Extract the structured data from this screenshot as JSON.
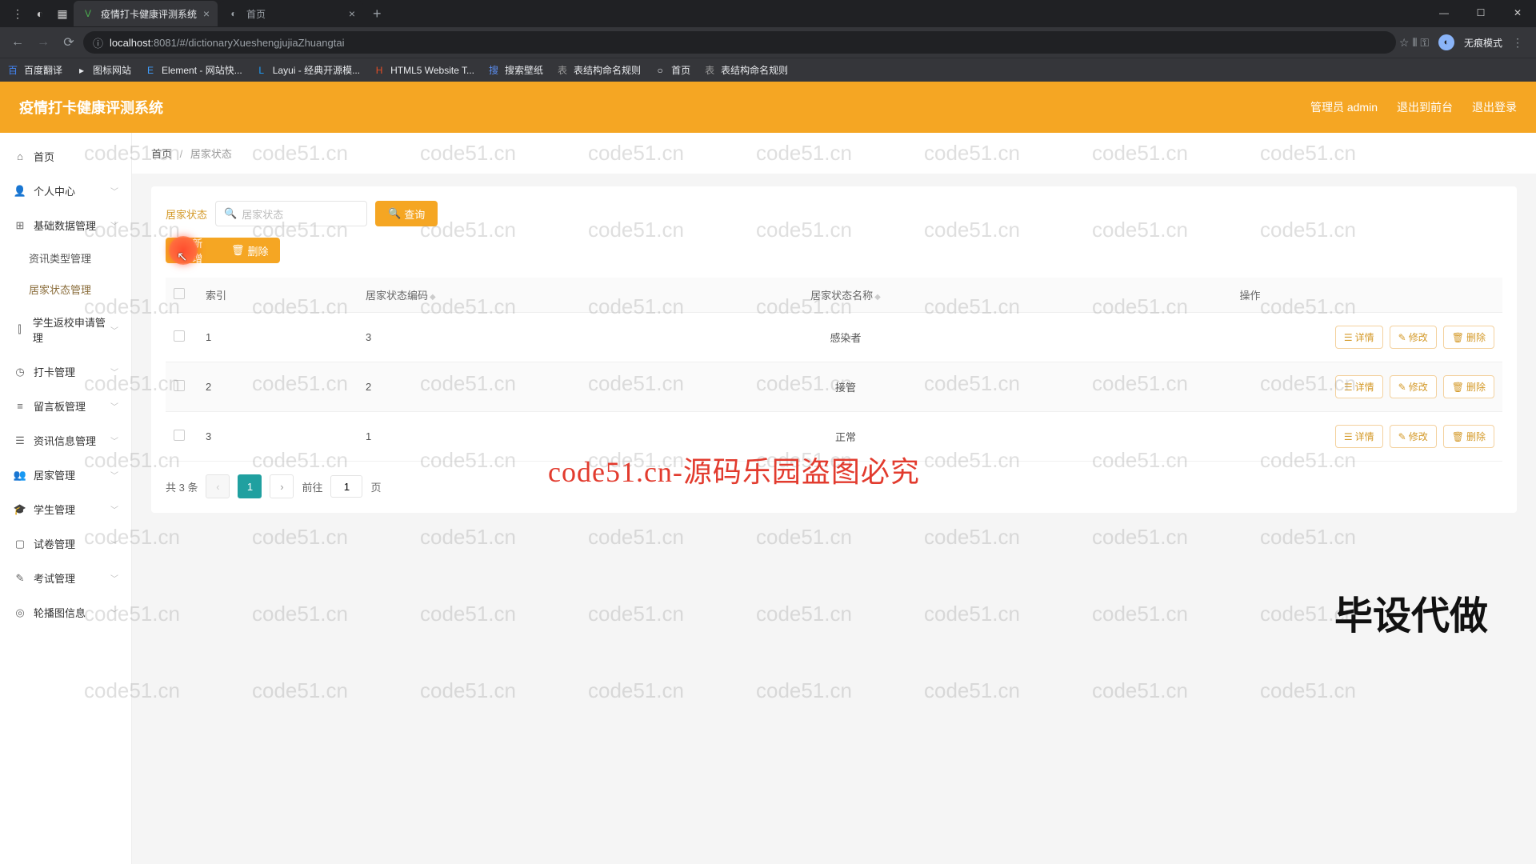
{
  "browser": {
    "tabs": [
      {
        "title": "疫情打卡健康评测系统",
        "active": true
      },
      {
        "title": "首页",
        "active": false
      }
    ],
    "url_prefix": "localhost",
    "url_port": ":8081",
    "url_path": "/#/dictionaryXueshengjujiaZhuangtai",
    "profile_label": "无痕模式",
    "bookmarks": [
      {
        "icon": "百",
        "label": "百度翻译"
      },
      {
        "icon": "▸",
        "label": "图标网站"
      },
      {
        "icon": "E",
        "label": "Element - 网站快..."
      },
      {
        "icon": "L",
        "label": "Layui - 经典开源模..."
      },
      {
        "icon": "H",
        "label": "HTML5 Website T..."
      },
      {
        "icon": "搜",
        "label": "搜索壁纸"
      },
      {
        "icon": "表",
        "label": "表结构命名规则"
      },
      {
        "icon": "○",
        "label": "首页"
      },
      {
        "icon": "表",
        "label": "表结构命名规则"
      }
    ]
  },
  "header": {
    "app_title": "疫情打卡健康评测系统",
    "user_label": "管理员 admin",
    "logout_front": "退出到前台",
    "logout": "退出登录"
  },
  "sidebar": {
    "items": [
      {
        "icon": "⌂",
        "label": "首页",
        "expandable": false
      },
      {
        "icon": "👤",
        "label": "个人中心",
        "expandable": true
      },
      {
        "icon": "⊞",
        "label": "基础数据管理",
        "expandable": true,
        "expanded": true,
        "children": [
          {
            "label": "资讯类型管理",
            "active": false
          },
          {
            "label": "居家状态管理",
            "active": true
          }
        ]
      },
      {
        "icon": "⫿",
        "label": "学生返校申请管理",
        "expandable": true
      },
      {
        "icon": "◷",
        "label": "打卡管理",
        "expandable": true
      },
      {
        "icon": "≡",
        "label": "留言板管理",
        "expandable": true
      },
      {
        "icon": "☰",
        "label": "资讯信息管理",
        "expandable": true
      },
      {
        "icon": "👥",
        "label": "居家管理",
        "expandable": true
      },
      {
        "icon": "🎓",
        "label": "学生管理",
        "expandable": true
      },
      {
        "icon": "▢",
        "label": "试卷管理",
        "expandable": true
      },
      {
        "icon": "✎",
        "label": "考试管理",
        "expandable": true
      },
      {
        "icon": "◎",
        "label": "轮播图信息",
        "expandable": true
      }
    ]
  },
  "breadcrumb": {
    "home": "首页",
    "current": "居家状态"
  },
  "filter": {
    "label": "居家状态",
    "placeholder": "居家状态",
    "search_btn": "查询",
    "add_btn": "新增",
    "delete_btn": "删除"
  },
  "table": {
    "headers": {
      "index": "索引",
      "code": "居家状态编码",
      "name": "居家状态名称",
      "ops": "操作"
    },
    "rows": [
      {
        "index": "1",
        "code": "3",
        "name": "感染者"
      },
      {
        "index": "2",
        "code": "2",
        "name": "接管"
      },
      {
        "index": "3",
        "code": "1",
        "name": "正常"
      }
    ],
    "op_labels": {
      "detail": "详情",
      "edit": "修改",
      "delete": "删除"
    }
  },
  "pagination": {
    "total_label": "共 3 条",
    "current": "1",
    "goto_prefix": "前往",
    "goto_value": "1",
    "goto_suffix": "页"
  },
  "watermark": {
    "text": "code51.cn",
    "red_text": "code51.cn-源码乐园盗图必究",
    "corner": "毕设代做"
  }
}
